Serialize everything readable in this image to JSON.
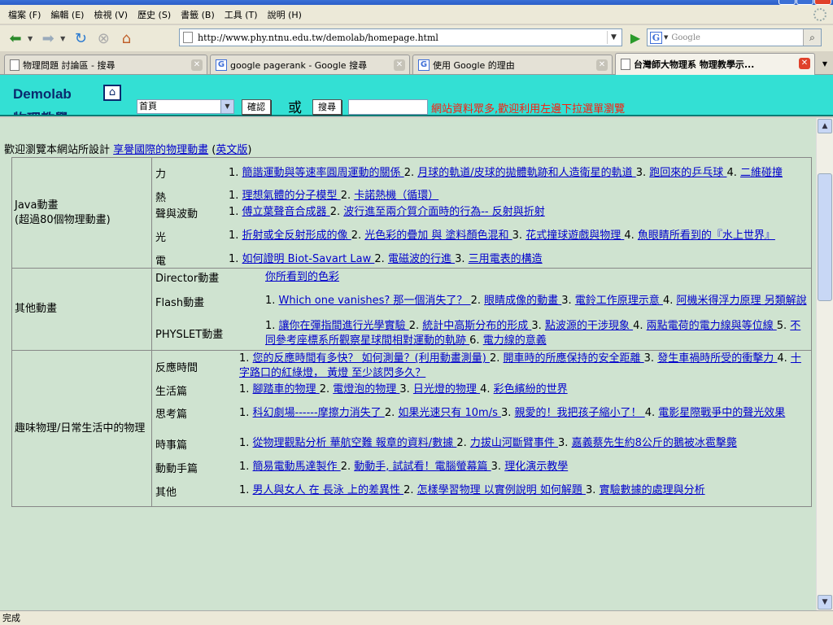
{
  "menu": [
    "檔案 (F)",
    "編輯 (E)",
    "檢視 (V)",
    "歷史 (S)",
    "書籤 (B)",
    "工具 (T)",
    "說明 (H)"
  ],
  "url": "http://www.phy.ntnu.edu.tw/demolab/homepage.html",
  "search_placeholder": "Google",
  "tabs": [
    "物理問題 討論區 - 搜尋",
    "google pagerank - Google 搜尋",
    "使用 Google 的理由",
    "台灣師大物理系 物理教學示..."
  ],
  "site": {
    "logo": "Demolab",
    "logo2": "物理教學",
    "select": "首頁",
    "confirm": "確認",
    "or": "或",
    "search": "搜尋",
    "notice": "網站資料眾多,歡迎利用左邊下拉選單瀏覽"
  },
  "welcome": {
    "pre": "歡迎瀏覽本網站所設計",
    "link": "享譽國際的物理動畫",
    "open": " (",
    "eng": "英文版",
    "close": ")"
  },
  "sections": [
    {
      "label": "Java動畫\n(超過80個物理動畫)",
      "rows": [
        {
          "cat": "力",
          "items": [
            "1.",
            "簡諧運動與等速率圓周運動的關係",
            "2.",
            "月球的軌道/皮球的拋體軌跡和人造衛星的軌道",
            "3.",
            "跑回來的乒乓球",
            "4.",
            "二維碰撞"
          ]
        },
        {
          "cat": "熱",
          "items": [
            "1.",
            "理想氣體的分子模型",
            "2.",
            "卡諾熱機（循環）"
          ]
        },
        {
          "cat": "聲與波動",
          "items": [
            "1.",
            "傅立葉聲音合成器",
            "2.",
            "波行進至兩介質介面時的行為-- 反射與折射"
          ]
        },
        {
          "cat": "光",
          "items": [
            "1.",
            "折射或全反射形成的像",
            "2.",
            "光色彩的疊加 與 塗料顏色混和",
            "3.",
            "花式撞球遊戲與物理",
            "4.",
            "魚眼睛所看到的『水上世界』"
          ]
        },
        {
          "cat": "電",
          "items": [
            "1.",
            "如何證明 Biot-Savart Law",
            "2.",
            "電磁波的行進",
            "3.",
            "三用電表的構造"
          ]
        }
      ]
    },
    {
      "label": "其他動畫",
      "rows": [
        {
          "cat": "Director動畫",
          "items": [
            "",
            "你所看到的色彩"
          ]
        },
        {
          "cat": "Flash動畫",
          "items": [
            "1.",
            "Which one vanishes? 那一個消失了？",
            "2.",
            "眼睛成像的動畫",
            "3.",
            "電鈴工作原理示意",
            "4.",
            "阿機米得浮力原理 另類解說"
          ]
        },
        {
          "cat": "PHYSLET動畫",
          "items": [
            "1.",
            "讓你在彈指間進行光學實驗",
            "2.",
            "統計中高斯分布的形成",
            "3.",
            "點波源的干涉現象",
            "4.",
            "兩點電荷的電力線與等位線",
            "5.",
            "不同參考座標系所觀察星球間相對運動的軌跡",
            "6.",
            "電力線的意義"
          ]
        }
      ]
    },
    {
      "label": "趣味物理/日常生活中的物理",
      "rows": [
        {
          "cat": "反應時間",
          "items": [
            "1.",
            "您的反應時間有多快？ 如何測量？(利用動畫測量)",
            "2.",
            "開車時的所應保持的安全距離",
            "3.",
            "發生車禍時所受的衝擊力",
            "4.",
            "十字路口的紅綠燈， 黃燈 至少該閃多久？"
          ]
        },
        {
          "cat": "生活篇",
          "items": [
            "1.",
            "腳踏車的物理",
            "2.",
            "電燈泡的物理",
            "3.",
            "日光燈的物理",
            "4.",
            "彩色繽紛的世界"
          ]
        },
        {
          "cat": "思考篇",
          "items": [
            "1.",
            "科幻劇場------摩擦力消失了",
            "2.",
            "如果光速只有 10m/s",
            "3.",
            "親愛的！我把孩子縮小了！",
            "4.",
            "電影星際戰爭中的聲光效果"
          ]
        },
        {
          "cat": "時事篇",
          "items": [
            "1.",
            "從物理觀點分析 華航空難 報章的資料/數據",
            "2.",
            "力拔山河斷臂事件",
            "3.",
            "嘉義蔡先生約8公斤的鵝被冰雹擊斃"
          ]
        },
        {
          "cat": "動動手篇",
          "items": [
            "1.",
            "簡易電動馬達製作",
            "2.",
            "動動手, 試試看！電腦螢幕篇",
            "3.",
            "理化演示教學"
          ]
        },
        {
          "cat": "其他",
          "items": [
            "1.",
            "男人與女人 在 長泳 上的差異性",
            "2.",
            "怎樣學習物理 以實例說明 如何解題",
            "3.",
            "實驗數據的處理與分析"
          ]
        }
      ]
    }
  ],
  "status": "完成"
}
